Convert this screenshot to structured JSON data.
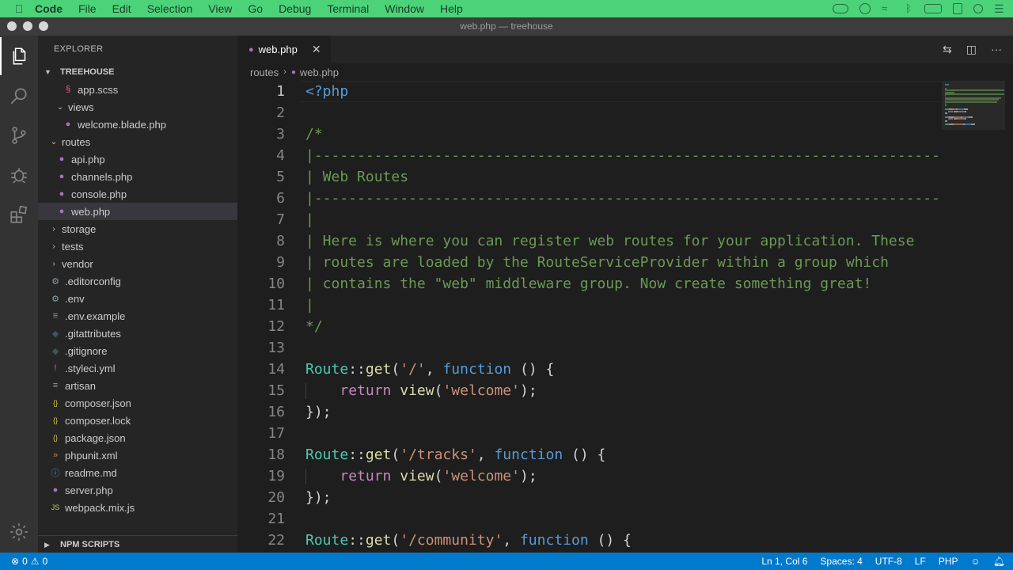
{
  "menubar": {
    "app": "Code",
    "items": [
      "File",
      "Edit",
      "Selection",
      "View",
      "Go",
      "Debug",
      "Terminal",
      "Window",
      "Help"
    ]
  },
  "window": {
    "title": "web.php — treehouse"
  },
  "activitybar": [
    "explorer-icon",
    "search-icon",
    "source-control-icon",
    "debug-icon",
    "extensions-icon",
    "manage-gear-icon"
  ],
  "sidebar": {
    "header": "EXPLORER",
    "section": "TREEHOUSE",
    "footer_section": "NPM SCRIPTS",
    "items": [
      {
        "label": "app.scss",
        "indent": 3,
        "icon": "sass-icon",
        "glyph": "§",
        "color": "#f55385",
        "type": "file"
      },
      {
        "label": "views",
        "indent": 2,
        "icon": "chevron-down-icon",
        "glyph": "⌄",
        "type": "folder"
      },
      {
        "label": "welcome.blade.php",
        "indent": 3,
        "icon": "php-icon",
        "glyph": "●",
        "color": "#a074c4",
        "type": "file"
      },
      {
        "label": "routes",
        "indent": 1,
        "icon": "chevron-down-icon",
        "glyph": "⌄",
        "type": "folder"
      },
      {
        "label": "api.php",
        "indent": 2,
        "icon": "php-icon",
        "glyph": "●",
        "color": "#a074c4",
        "type": "file"
      },
      {
        "label": "channels.php",
        "indent": 2,
        "icon": "php-icon",
        "glyph": "●",
        "color": "#a074c4",
        "type": "file"
      },
      {
        "label": "console.php",
        "indent": 2,
        "icon": "php-icon",
        "glyph": "●",
        "color": "#a074c4",
        "type": "file"
      },
      {
        "label": "web.php",
        "indent": 2,
        "icon": "php-icon",
        "glyph": "●",
        "color": "#a074c4",
        "type": "file",
        "selected": true
      },
      {
        "label": "storage",
        "indent": 1,
        "icon": "chevron-right-icon",
        "glyph": "›",
        "type": "folder"
      },
      {
        "label": "tests",
        "indent": 1,
        "icon": "chevron-right-icon",
        "glyph": "›",
        "type": "folder"
      },
      {
        "label": "vendor",
        "indent": 1,
        "icon": "chevron-right-icon",
        "glyph": "›",
        "type": "folder"
      },
      {
        "label": ".editorconfig",
        "indent": 1,
        "icon": "gear-icon",
        "glyph": "⚙",
        "color": "#8f9ea8",
        "type": "file"
      },
      {
        "label": ".env",
        "indent": 1,
        "icon": "gear-icon",
        "glyph": "⚙",
        "color": "#8f9ea8",
        "type": "file"
      },
      {
        "label": ".env.example",
        "indent": 1,
        "icon": "lines-icon",
        "glyph": "≡",
        "color": "#8f9ea8",
        "type": "file"
      },
      {
        "label": ".gitattributes",
        "indent": 1,
        "icon": "git-icon",
        "glyph": "◆",
        "color": "#41535b",
        "type": "file"
      },
      {
        "label": ".gitignore",
        "indent": 1,
        "icon": "git-icon",
        "glyph": "◆",
        "color": "#41535b",
        "type": "file"
      },
      {
        "label": ".styleci.yml",
        "indent": 1,
        "icon": "yaml-icon",
        "glyph": "!",
        "color": "#a074c4",
        "type": "file"
      },
      {
        "label": "artisan",
        "indent": 1,
        "icon": "lines-icon",
        "glyph": "≡",
        "color": "#8f9ea8",
        "type": "file"
      },
      {
        "label": "composer.json",
        "indent": 1,
        "icon": "json-icon",
        "glyph": "{}",
        "color": "#cbcb41",
        "type": "file"
      },
      {
        "label": "composer.lock",
        "indent": 1,
        "icon": "json-icon",
        "glyph": "{}",
        "color": "#cbcb41",
        "type": "file"
      },
      {
        "label": "package.json",
        "indent": 1,
        "icon": "json-icon",
        "glyph": "{}",
        "color": "#cbcb41",
        "type": "file"
      },
      {
        "label": "phpunit.xml",
        "indent": 1,
        "icon": "rss-icon",
        "glyph": "»",
        "color": "#e37933",
        "type": "file"
      },
      {
        "label": "readme.md",
        "indent": 1,
        "icon": "info-icon",
        "glyph": "ⓘ",
        "color": "#519aba",
        "type": "file"
      },
      {
        "label": "server.php",
        "indent": 1,
        "icon": "php-icon",
        "glyph": "●",
        "color": "#a074c4",
        "type": "file"
      },
      {
        "label": "webpack.mix.js",
        "indent": 1,
        "icon": "js-icon",
        "glyph": "JS",
        "color": "#cbcb41",
        "type": "file"
      }
    ]
  },
  "editor": {
    "tab_label": "web.php",
    "breadcrumb": [
      "routes",
      "web.php"
    ],
    "lines": [
      [
        [
          "<?php",
          "tag"
        ]
      ],
      [],
      [
        [
          "/*",
          "cmt"
        ]
      ],
      [
        [
          "|--------------------------------------------------------------------------",
          "cmt"
        ]
      ],
      [
        [
          "| Web Routes",
          "cmt"
        ]
      ],
      [
        [
          "|--------------------------------------------------------------------------",
          "cmt"
        ]
      ],
      [
        [
          "|",
          "cmt"
        ]
      ],
      [
        [
          "| Here is where you can register web routes for your application. These",
          "cmt"
        ]
      ],
      [
        [
          "| routes are loaded by the RouteServiceProvider within a group which",
          "cmt"
        ]
      ],
      [
        [
          "| contains the \"web\" middleware group. Now create something great!",
          "cmt"
        ]
      ],
      [
        [
          "|",
          "cmt"
        ]
      ],
      [
        [
          "*/",
          "cmt"
        ]
      ],
      [],
      [
        [
          "Route",
          "cls"
        ],
        [
          "::",
          "op"
        ],
        [
          "get",
          "fn"
        ],
        [
          "(",
          "pl"
        ],
        [
          "'/'",
          "str"
        ],
        [
          ", ",
          "pl"
        ],
        [
          "function",
          "kw"
        ],
        [
          " () {",
          "pl"
        ]
      ],
      [
        [
          "    ",
          "pl"
        ],
        [
          "return",
          "ret"
        ],
        [
          " ",
          "pl"
        ],
        [
          "view",
          "fn"
        ],
        [
          "(",
          "pl"
        ],
        [
          "'welcome'",
          "str"
        ],
        [
          ");",
          "pl"
        ]
      ],
      [
        [
          "});",
          "pl"
        ]
      ],
      [],
      [
        [
          "Route",
          "cls"
        ],
        [
          "::",
          "op"
        ],
        [
          "get",
          "fn"
        ],
        [
          "(",
          "pl"
        ],
        [
          "'/tracks'",
          "str"
        ],
        [
          ", ",
          "pl"
        ],
        [
          "function",
          "kw"
        ],
        [
          " () {",
          "pl"
        ]
      ],
      [
        [
          "    ",
          "pl"
        ],
        [
          "return",
          "ret"
        ],
        [
          " ",
          "pl"
        ],
        [
          "view",
          "fn"
        ],
        [
          "(",
          "pl"
        ],
        [
          "'welcome'",
          "str"
        ],
        [
          ");",
          "pl"
        ]
      ],
      [
        [
          "});",
          "pl"
        ]
      ],
      [],
      [
        [
          "Route",
          "cls"
        ],
        [
          "::",
          "op"
        ],
        [
          "get",
          "fn"
        ],
        [
          "(",
          "pl"
        ],
        [
          "'/community'",
          "str"
        ],
        [
          ", ",
          "pl"
        ],
        [
          "function",
          "kw"
        ],
        [
          " () {",
          "pl"
        ]
      ]
    ]
  },
  "statusbar": {
    "errors": "0",
    "warnings": "0",
    "position": "Ln 1, Col 6",
    "spaces": "Spaces: 4",
    "encoding": "UTF-8",
    "eol": "LF",
    "language": "PHP"
  },
  "colors": {
    "menubar": "#4cd37a",
    "statusbar": "#007acc",
    "sidebar": "#252526",
    "editor": "#1e1e1e"
  }
}
